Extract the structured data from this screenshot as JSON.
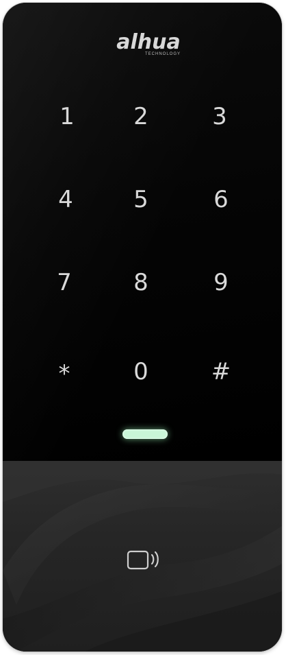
{
  "brand": {
    "name": "alhua",
    "tagline": "TECHNOLOGY"
  },
  "keypad": {
    "keys": [
      "1",
      "2",
      "3",
      "4",
      "5",
      "6",
      "7",
      "8",
      "9",
      "*",
      "0",
      "#"
    ]
  },
  "indicator": {
    "color": "#c9f6d8"
  },
  "reader": {
    "icon": "rfid-card-icon"
  }
}
